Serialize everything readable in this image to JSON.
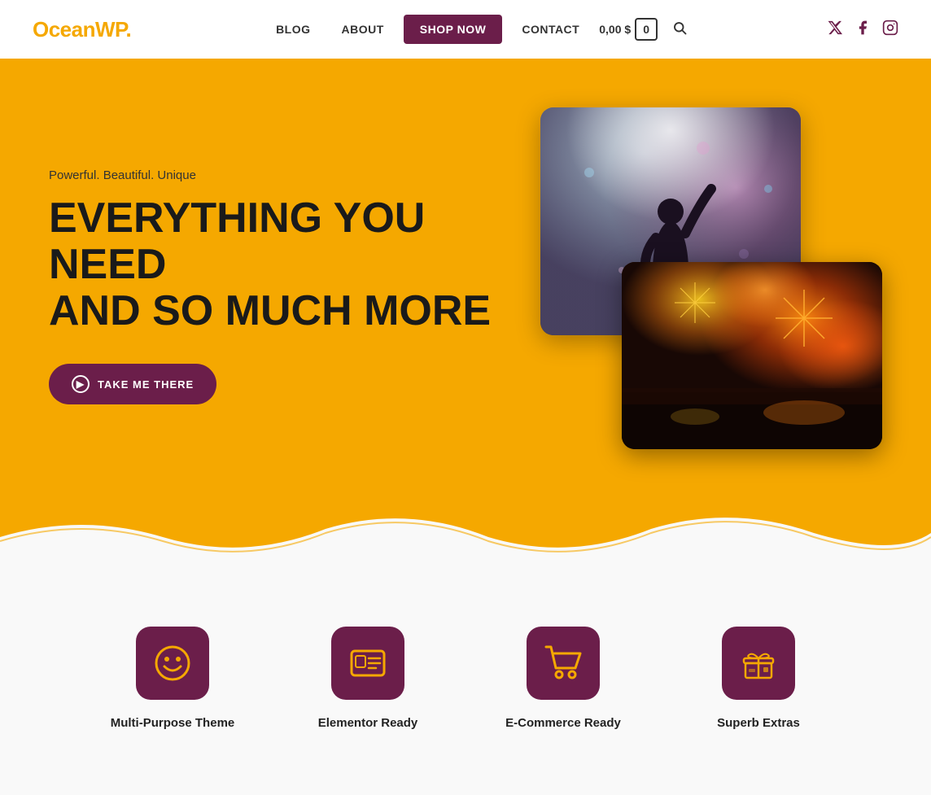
{
  "logo": {
    "text": "OceanWP",
    "dot": "."
  },
  "nav": {
    "blog": "BLOG",
    "about": "ABOUT",
    "shop": "SHOP NOW",
    "contact": "CONTACT",
    "cart_price": "0,00 $",
    "cart_count": "0"
  },
  "hero": {
    "subtitle": "Powerful. Beautiful. Unique",
    "title_line1": "EVERYTHING YOU NEED",
    "title_line2": "AND SO MUCH MORE",
    "cta": "TAKE ME THERE"
  },
  "features": [
    {
      "label": "Multi-Purpose Theme",
      "icon": "😊"
    },
    {
      "label": "Elementor Ready",
      "icon": "🪪"
    },
    {
      "label": "E-Commerce Ready",
      "icon": "🛒"
    },
    {
      "label": "Superb Extras",
      "icon": "🎁"
    }
  ],
  "social": {
    "twitter": "𝕏",
    "facebook": "f",
    "instagram": "📷"
  }
}
